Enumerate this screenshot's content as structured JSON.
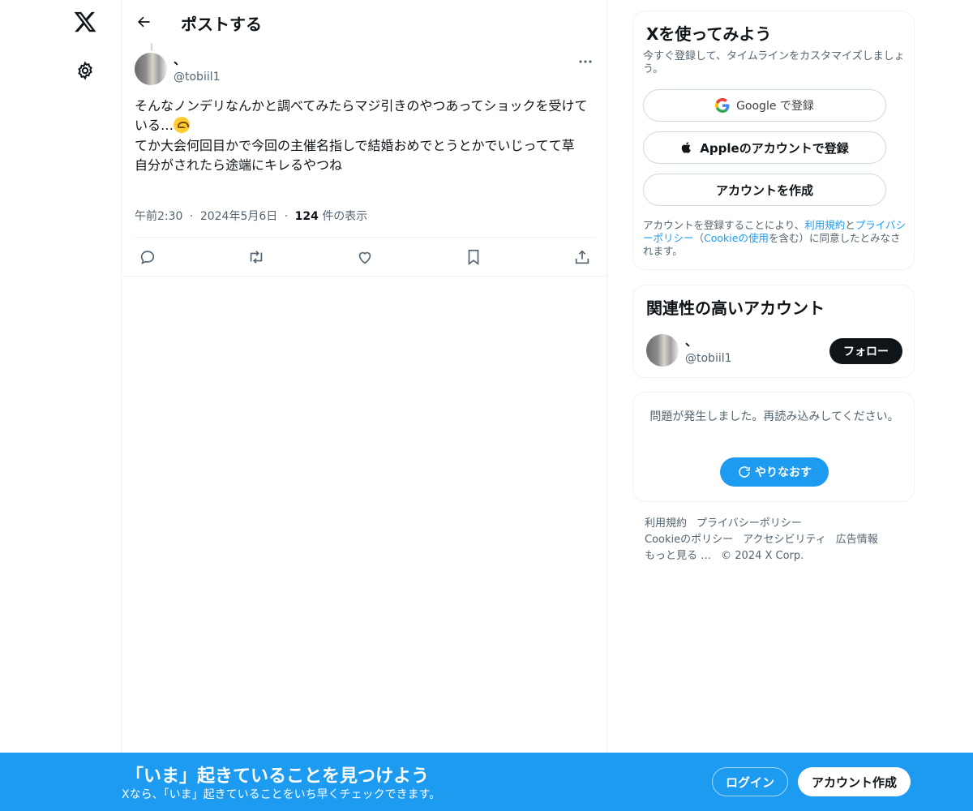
{
  "nav": {
    "logo_icon": "x-logo-icon",
    "settings_icon": "gear-icon"
  },
  "header": {
    "back_icon": "arrow-left-icon",
    "title": "ポストする"
  },
  "post": {
    "author_name": "、",
    "author_handle": "@tobiil1",
    "text_lines": [
      "そんなノンデリなんかと調べてみたらマジ引きのやつあってショックを受けている…",
      "てか大会何回目かで今回の主催名指しで結婚おめでとうとかでいじってて草",
      "自分がされたら途端にキレるやつね"
    ],
    "emoji_icon": "upside-down-face-icon",
    "time": "午前2:30",
    "dot": "·",
    "date": "2024年5月6日",
    "views_count": "124",
    "views_label": "件の表示",
    "actions": [
      "reply-icon",
      "repost-icon",
      "like-icon",
      "bookmark-icon",
      "share-icon"
    ]
  },
  "signup": {
    "title": "Xを使ってみよう",
    "subtitle": "今すぐ登録して、タイムラインをカスタマイズしましょう。",
    "google_label": "Google で登録",
    "apple_label": "Appleのアカウントで登録",
    "create_label": "アカウントを作成",
    "legal_prefix": "アカウントを登録することにより、",
    "terms_link": "利用規約",
    "and": "と",
    "privacy_link": "プライバシーポリシー",
    "paren_open": "（",
    "cookie_link": "Cookieの使用",
    "paren_close": "を含む）に同意したとみなされます。"
  },
  "related": {
    "title": "関連性の高いアカウント",
    "name": "、",
    "handle": "@tobiil1",
    "follow_label": "フォロー"
  },
  "error_card": {
    "message": "問題が発生しました。再読み込みしてください。",
    "retry_label": "やりなおす"
  },
  "footer": {
    "links": [
      "利用規約",
      "プライバシーポリシー",
      "Cookieのポリシー",
      "アクセシビリティ",
      "広告情報",
      "もっと見る …"
    ],
    "copyright": "© 2024 X Corp."
  },
  "banner": {
    "title": "「いま」起きていることを見つけよう",
    "subtitle": "Xなら、「いま」起きていることをいち早くチェックできます。",
    "login_label": "ログイン",
    "signup_label": "アカウント作成"
  },
  "colors": {
    "accent": "#1d9bf0",
    "text": "#0f1419",
    "muted": "#536471",
    "border": "#eff3f4"
  }
}
